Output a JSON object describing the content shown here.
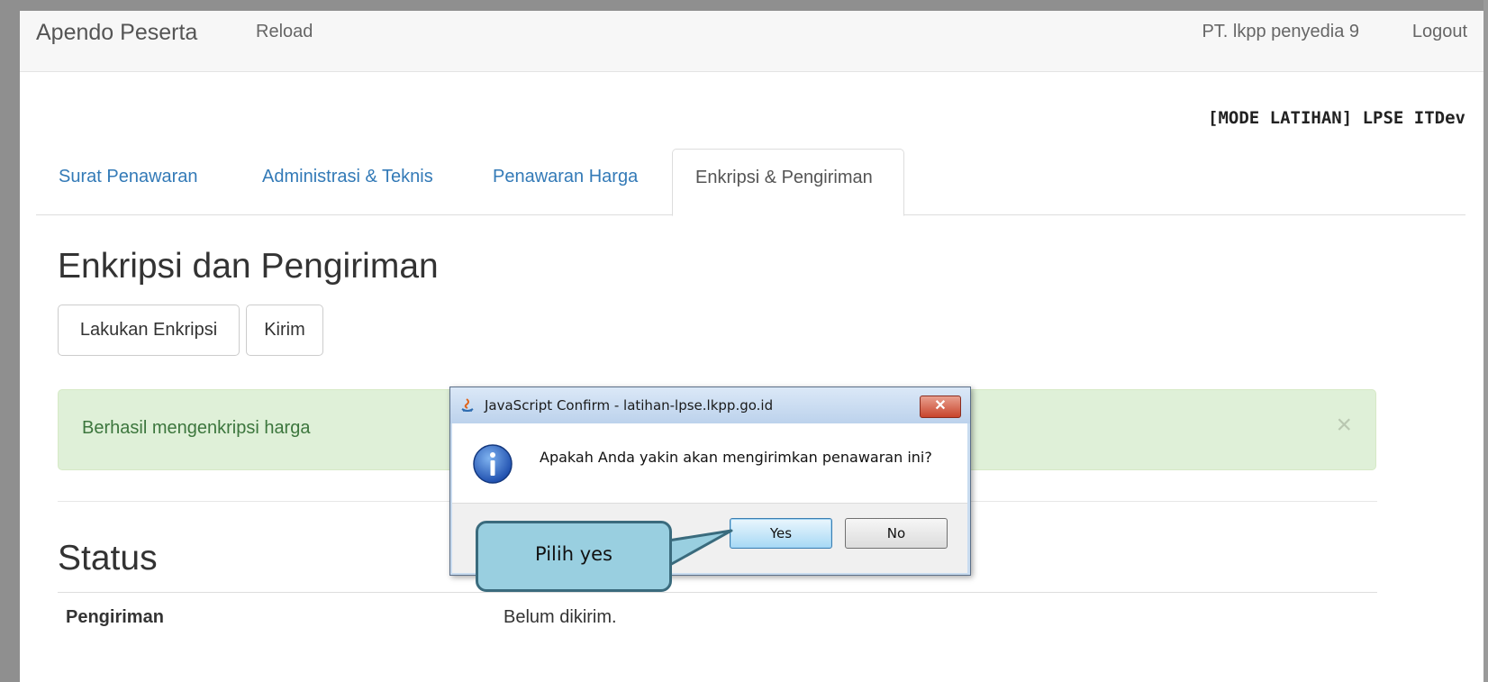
{
  "navbar": {
    "brand": "Apendo Peserta",
    "reload": "Reload",
    "user": "PT. lkpp penyedia 9",
    "logout": "Logout"
  },
  "mode_title": "[MODE LATIHAN] LPSE ITDev",
  "tabs": [
    {
      "label": "Surat Penawaran",
      "active": false
    },
    {
      "label": "Administrasi & Teknis",
      "active": false
    },
    {
      "label": "Penawaran Harga",
      "active": false
    },
    {
      "label": "Enkripsi & Pengiriman",
      "active": true
    }
  ],
  "section": {
    "heading": "Enkripsi dan Pengiriman",
    "encrypt_button": "Lakukan Enkripsi",
    "send_button": "Kirim"
  },
  "alert": {
    "text": "Berhasil mengenkripsi harga",
    "close": "×"
  },
  "status": {
    "heading": "Status",
    "rows": [
      {
        "key": "Pengiriman",
        "value": "Belum dikirim."
      }
    ]
  },
  "dialog": {
    "title": "JavaScript Confirm - latihan-lpse.lkpp.go.id",
    "close": "✕",
    "message": "Apakah Anda yakin akan mengirimkan penawaran ini?",
    "yes": "Yes",
    "no": "No"
  },
  "callout": {
    "text": "Pilih yes"
  },
  "colors": {
    "link": "#337ab7",
    "alert_bg": "#dff0d8",
    "alert_text": "#3c763d",
    "callout_bg": "#99cfe0",
    "callout_border": "#3a6b7d"
  }
}
